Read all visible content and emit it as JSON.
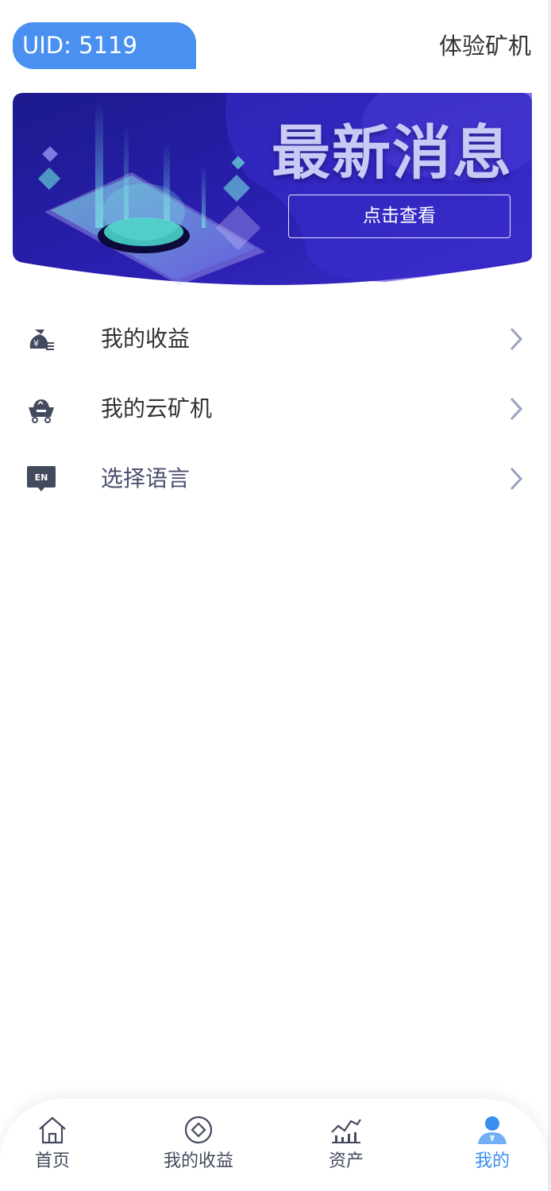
{
  "header": {
    "uid": "UID: 5119",
    "trial_link": "体验矿机"
  },
  "banner": {
    "title": "最新消息",
    "button_label": "点击查看"
  },
  "menu": {
    "items": [
      {
        "label": "我的收益",
        "icon": "money-bag-icon"
      },
      {
        "label": "我的云矿机",
        "icon": "mining-cart-icon"
      },
      {
        "label": "选择语言",
        "icon": "language-en-icon",
        "icon_text": "EN"
      }
    ]
  },
  "tabbar": {
    "tabs": [
      {
        "label": "首页",
        "icon": "home-icon",
        "active": false
      },
      {
        "label": "我的收益",
        "icon": "coin-icon",
        "active": false
      },
      {
        "label": "资产",
        "icon": "chart-icon",
        "active": false
      },
      {
        "label": "我的",
        "icon": "user-icon",
        "active": true
      }
    ]
  },
  "colors": {
    "accent": "#4a90f0",
    "active_tab": "#3a8eef",
    "banner_bg": "#2b1aa8",
    "text_primary": "#333333",
    "icon_dark": "#444a5e"
  }
}
